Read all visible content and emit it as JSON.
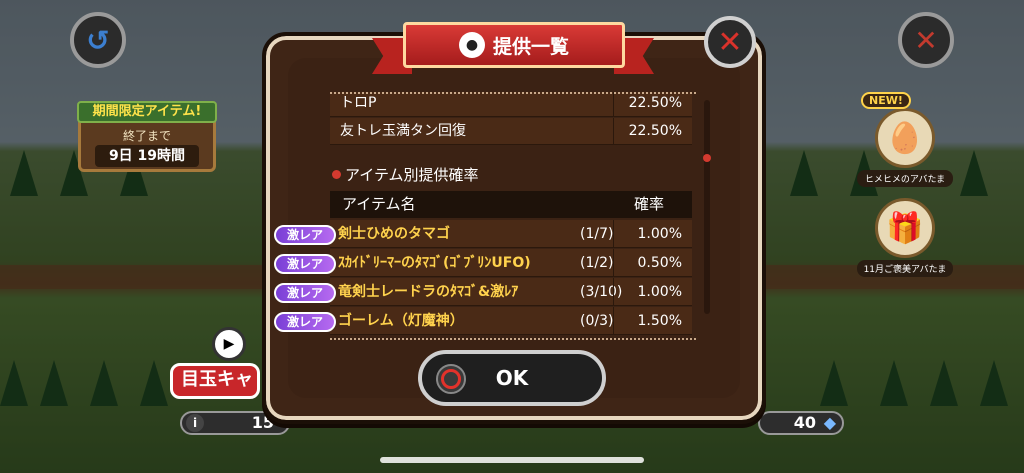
{
  "hud": {
    "back_icon": "back-arrow-icon",
    "close_bg_icon": "close-icon",
    "limited": {
      "title": "期間限定アイテム!",
      "until": "終了まで",
      "time": "9日 19時間"
    },
    "side_items": [
      {
        "badge": "NEW!",
        "label": "ヒメヒメのアバたま",
        "icon": "avatar-egg-icon"
      },
      {
        "label": "11月ご褒美アバたま",
        "icon": "gift-box-icon"
      }
    ],
    "gacha_label": "目玉キャ",
    "left_count": "15",
    "right_count": "40"
  },
  "modal": {
    "title": "提供一覧",
    "title_icon": "drop-icon",
    "rate_rows": [
      {
        "name": "トロP",
        "pct": "22.50%"
      },
      {
        "name": "友トレ玉満タン回復",
        "pct": "22.50%"
      }
    ],
    "section_title": "アイテム別提供確率",
    "table_header": {
      "item": "アイテム名",
      "rate": "確率"
    },
    "items": [
      {
        "rarity": "激レア",
        "name": "剣士ひめのタマゴ",
        "stock": "(1/7)",
        "pct": "1.00%"
      },
      {
        "rarity": "激レア",
        "name": "ｽｶｲﾄﾞﾘｰﾏｰのﾀﾏｺﾞ(ｺﾞﾌﾞﾘﾝUFO)",
        "stock": "(1/2)",
        "pct": "0.50%"
      },
      {
        "rarity": "激レア",
        "name": "竜剣士レードラのﾀﾏｺﾞ&激ﾚｱ",
        "stock": "(3/10)",
        "pct": "1.00%"
      },
      {
        "rarity": "激レア",
        "name": "ゴーレム（灯魔神）",
        "stock": "(0/3)",
        "pct": "1.50%"
      }
    ],
    "ok_label": "OK"
  },
  "colors": {
    "ribbon": "#c82a28",
    "modal_bg": "#3f2516",
    "rarity": "#9a50e6",
    "item_name": "#ffd24d"
  }
}
